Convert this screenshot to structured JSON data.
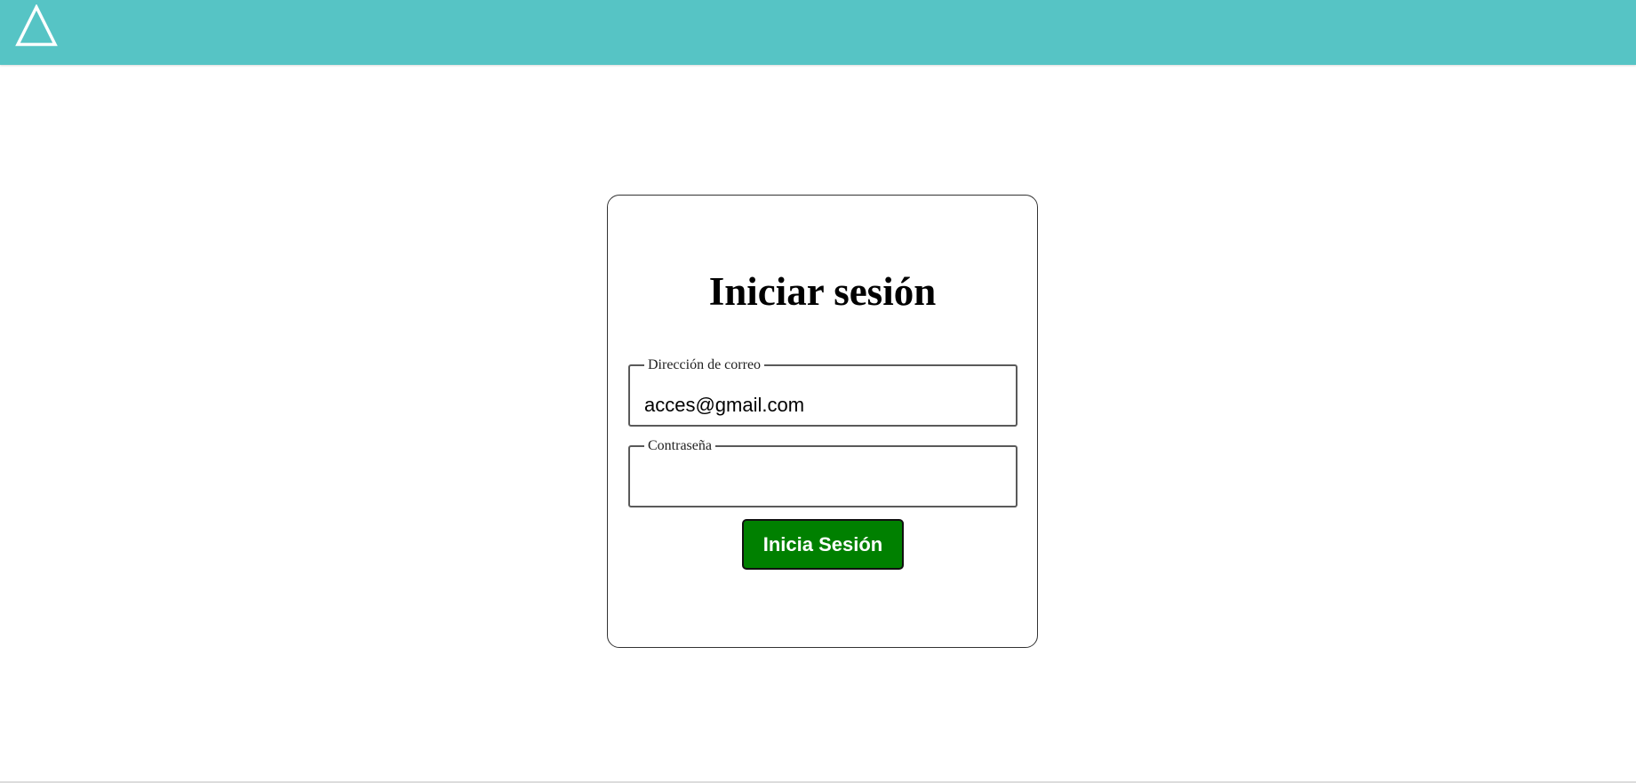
{
  "header": {
    "background_color": "#56c4c5",
    "logo_icon": "triangle-logo-icon"
  },
  "login": {
    "title": "Iniciar sesión",
    "email": {
      "label": "Dirección de correo",
      "value": "acces@gmail.com"
    },
    "password": {
      "label": "Contraseña",
      "value": ""
    },
    "submit_label": "Inicia Sesión",
    "submit_color": "#008000"
  }
}
